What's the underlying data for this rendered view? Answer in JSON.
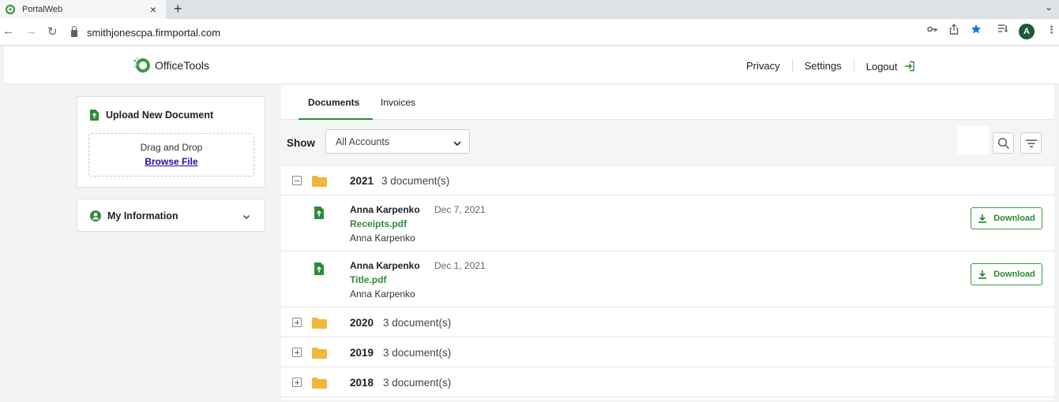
{
  "browser": {
    "tab_title": "PortalWeb",
    "url": "smithjonescpa.firmportal.com",
    "profile_initial": "A"
  },
  "header": {
    "logo_text": "OfficeTools",
    "links": [
      "Privacy",
      "Settings",
      "Logout"
    ]
  },
  "sidebar": {
    "upload": {
      "title": "Upload New Document",
      "drop_text": "Drag and Drop",
      "browse_label": "Browse File"
    },
    "my_information": {
      "title": "My Information"
    }
  },
  "main": {
    "tabs": [
      {
        "label": "Documents",
        "active": true
      },
      {
        "label": "Invoices",
        "active": false
      }
    ],
    "filter": {
      "show_label": "Show",
      "account_select": "All Accounts"
    },
    "groups": [
      {
        "year": "2021",
        "count": "3 document(s)",
        "expanded": true,
        "documents": [
          {
            "author": "Anna Karpenko",
            "date": "Dec 7, 2021",
            "file": "Receipts.pdf",
            "owner": "Anna Karpenko",
            "action": "Download"
          },
          {
            "author": "Anna Karpenko",
            "date": "Dec 1, 2021",
            "file": "Title.pdf",
            "owner": "Anna Karpenko",
            "action": "Download"
          }
        ]
      },
      {
        "year": "2020",
        "count": "3 document(s)",
        "expanded": false
      },
      {
        "year": "2019",
        "count": "3 document(s)",
        "expanded": false
      },
      {
        "year": "2018",
        "count": "3 document(s)",
        "expanded": false
      }
    ]
  },
  "colors": {
    "accent": "#2e8b3a",
    "folder": "#f0b73a",
    "link": "#1a0dab",
    "star": "#1a73e8"
  }
}
